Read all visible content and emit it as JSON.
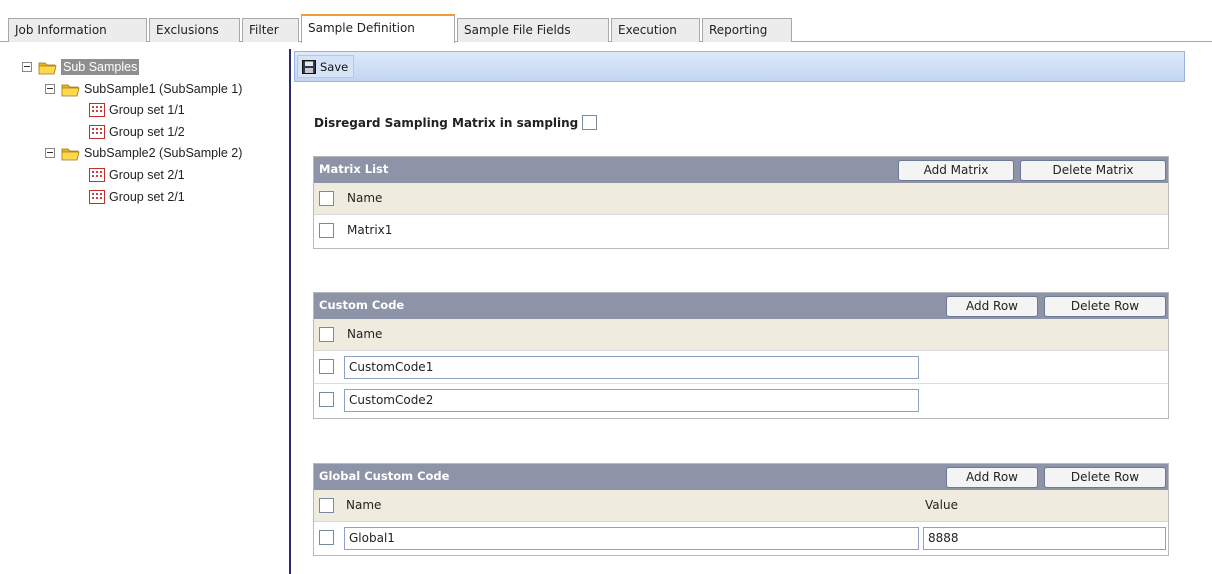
{
  "tabs": [
    {
      "label": "Job Information"
    },
    {
      "label": "Exclusions"
    },
    {
      "label": "Filter"
    },
    {
      "label": "Sample Definition",
      "active": true
    },
    {
      "label": "Sample File Fields"
    },
    {
      "label": "Execution"
    },
    {
      "label": "Reporting"
    }
  ],
  "tree": {
    "root": "Sub Samples",
    "subsamples": [
      {
        "label": "SubSample1 (SubSample 1)",
        "groups": [
          "Group set 1/1",
          "Group set 1/2"
        ]
      },
      {
        "label": "SubSample2 (SubSample 2)",
        "groups": [
          "Group set 2/1",
          "Group set 2/1"
        ]
      }
    ]
  },
  "toolbar": {
    "save_label": "Save"
  },
  "disregard": {
    "label": "Disregard Sampling Matrix in sampling",
    "checked": false
  },
  "matrix_list": {
    "title": "Matrix List",
    "add_label": "Add Matrix",
    "delete_label": "Delete Matrix",
    "column_name": "Name",
    "rows": [
      "Matrix1"
    ]
  },
  "custom_code": {
    "title": "Custom Code",
    "add_label": "Add Row",
    "delete_label": "Delete Row",
    "column_name": "Name",
    "rows": [
      "CustomCode1",
      "CustomCode2"
    ]
  },
  "global_custom_code": {
    "title": "Global Custom Code",
    "add_label": "Add Row",
    "delete_label": "Delete Row",
    "column_name": "Name",
    "column_value": "Value",
    "rows": [
      {
        "name": "Global1",
        "value": "8888"
      }
    ]
  },
  "colors": {
    "active_tab_accent": "#f0a030",
    "panel_header": "#8d94a8",
    "toolbar": "#c2d5f1",
    "grid_header": "#efecdf"
  }
}
